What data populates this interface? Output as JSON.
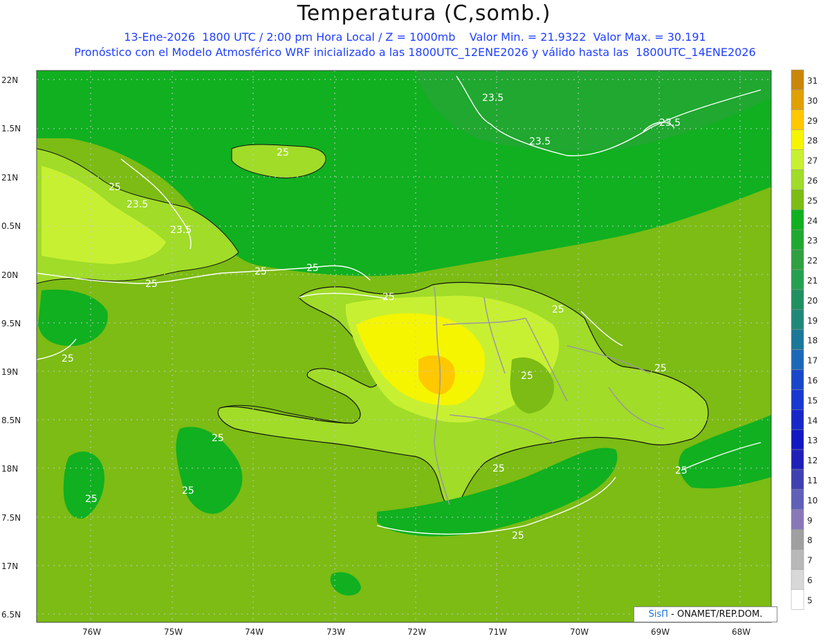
{
  "title": "Temperatura (C,somb.)",
  "subtitle1": "13-Ene-2026  1800 UTC / 2:00 pm Hora Local / Z = 1000mb    Valor Min. = 21.9322  Valor Max. = 30.191",
  "subtitle2": "Pronóstico con el Modelo Atmosférico WRF inicializado a las 1800UTC_12ENE2026 y válido hasta las  1800UTC_14ENE2026",
  "credit": {
    "brand": "SisΠ",
    "text": " - ONAMET/REP.DOM."
  },
  "lat_labels": [
    "22N",
    "1.5N",
    "21N",
    "0.5N",
    "20N",
    "9.5N",
    "19N",
    "8.5N",
    "18N",
    "7.5N",
    "17N",
    "6.5N"
  ],
  "lon_labels": [
    "76W",
    "75W",
    "74W",
    "73W",
    "72W",
    "71W",
    "70W",
    "69W",
    "68W"
  ],
  "colorbar": {
    "levels": [
      "31",
      "30",
      "29",
      "28",
      "27",
      "26",
      "25",
      "24",
      "23",
      "22",
      "21",
      "20",
      "19",
      "18",
      "17",
      "16",
      "15",
      "14",
      "13",
      "12",
      "11",
      "10",
      "9",
      "8",
      "7",
      "6",
      "5"
    ],
    "colors": [
      "#c8860a",
      "#e0a000",
      "#ffc800",
      "#f5f500",
      "#c8f032",
      "#a0dc28",
      "#7cbc14",
      "#10b020",
      "#20a830",
      "#30a040",
      "#24a050",
      "#209060",
      "#208878",
      "#1c7898",
      "#1c68b8",
      "#1848c8",
      "#1838d0",
      "#1828c8",
      "#1418c0",
      "#2020b8",
      "#4040b0",
      "#6060b8",
      "#8878b8",
      "#a0a0a0",
      "#b8b8b8",
      "#d8d8d8",
      "#ffffff"
    ]
  },
  "contour_labels": [
    "23.5",
    "23.5",
    "23.5",
    "23.5",
    "23.5",
    "25",
    "25",
    "25",
    "25",
    "25",
    "25",
    "25",
    "25",
    "25",
    "25",
    "25",
    "25",
    "25",
    "25",
    "25",
    "25"
  ],
  "colors": {
    "ocean": "#7cbc14",
    "land_warm": "#c8f032",
    "land_hot": "#f5f500",
    "north_sea": "#10b020",
    "cool_patch": "#20a830"
  }
}
